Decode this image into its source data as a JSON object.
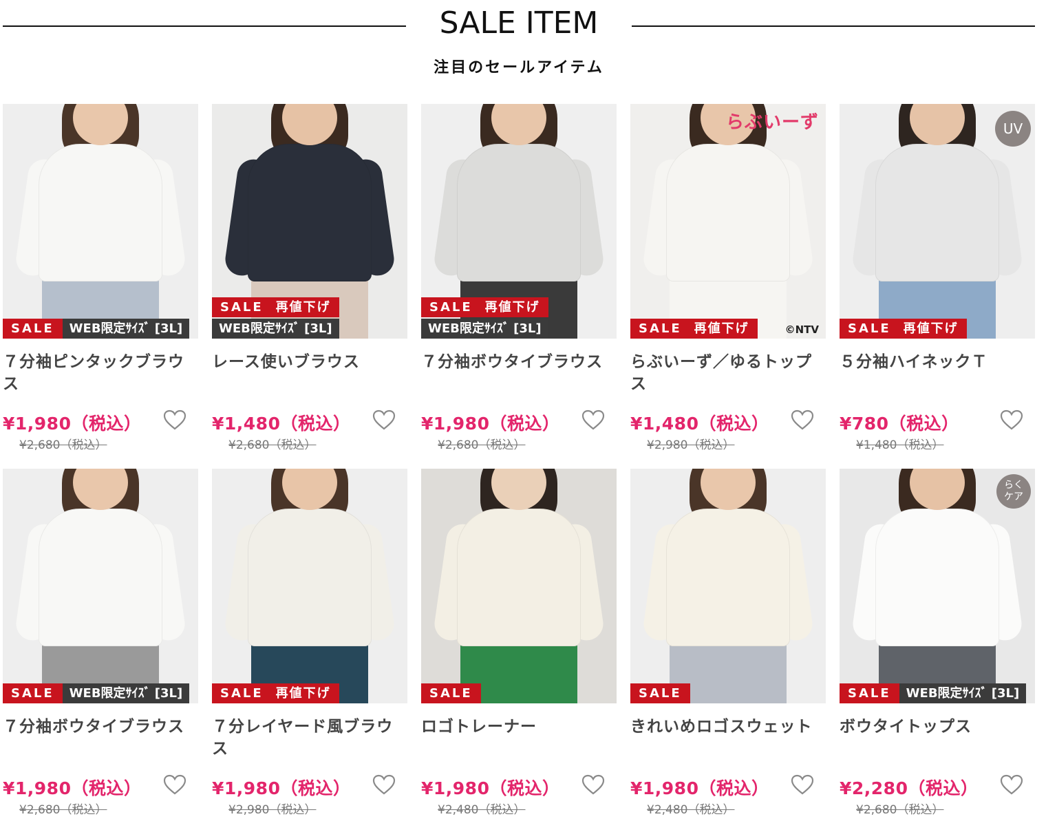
{
  "header": {
    "title": "SALE ITEM",
    "subtitle": "注目のセールアイテム"
  },
  "products": [
    {
      "name": "７分袖ピンタックブラウス",
      "price": "¥1,980（税込）",
      "original": "¥2,680（税込）",
      "tags": [
        "SALE",
        "WEB限定ｻｲｽﾞ [3L]"
      ],
      "tag_layout": "inline",
      "bg": "#eeeeee",
      "top": "#f7f7f5",
      "bottom_color": "#b5bfcc",
      "hair": "#4a3528",
      "skin": "#e9c7ab"
    },
    {
      "name": "レース使いブラウス",
      "price": "¥1,480（税込）",
      "original": "¥2,680（税込）",
      "tags": [
        "SALE",
        "再値下げ",
        "WEB限定ｻｲｽﾞ [3L]"
      ],
      "tag_layout": "stacked",
      "bg": "#ebebea",
      "top": "#2a2f3a",
      "bottom_color": "#d9c9bd",
      "hair": "#3b2a20",
      "skin": "#e6c2a5"
    },
    {
      "name": "７分袖ボウタイブラウス",
      "price": "¥1,980（税込）",
      "original": "¥2,680（税込）",
      "tags": [
        "SALE",
        "再値下げ",
        "WEB限定ｻｲｽﾞ [3L]"
      ],
      "tag_layout": "stacked",
      "bg": "#efefef",
      "top": "#dcdcda",
      "bottom_color": "#3a3a3a",
      "hair": "#3a2a20",
      "skin": "#e8c6aa"
    },
    {
      "name": "らぶいーず／ゆるトップス",
      "price": "¥1,480（税込）",
      "original": "¥2,980（税込）",
      "tags": [
        "SALE",
        "再値下げ"
      ],
      "tag_layout": "inline",
      "bg": "#f0efed",
      "top": "#f6f5f2",
      "bottom_color": "#f6f5f2",
      "hair": "#3a2a20",
      "skin": "#e8c6aa",
      "brand": "らぶいーず",
      "corner": "©NTV"
    },
    {
      "name": "５分袖ハイネックＴ",
      "price": "¥780（税込）",
      "original": "¥1,480（税込）",
      "tags": [
        "SALE",
        "再値下げ"
      ],
      "tag_layout": "inline",
      "bg": "#eeeeee",
      "top": "#e6e6e6",
      "bottom_color": "#8eaac8",
      "hair": "#2e2520",
      "skin": "#e6c3a7",
      "badge": "UV"
    },
    {
      "name": "７分袖ボウタイブラウス",
      "price": "¥1,980（税込）",
      "original": "¥2,680（税込）",
      "tags": [
        "SALE",
        "WEB限定ｻｲｽﾞ [3L]"
      ],
      "tag_layout": "inline",
      "bg": "#eeeeee",
      "top": "#f8f8f6",
      "bottom_color": "#9a9a9a",
      "hair": "#4a3528",
      "skin": "#e9c7ab"
    },
    {
      "name": "７分レイヤード風ブラウス",
      "price": "¥1,980（税込）",
      "original": "¥2,980（税込）",
      "tags": [
        "SALE",
        "再値下げ"
      ],
      "tag_layout": "inline",
      "bg": "#eeeeee",
      "top": "#f1efe8",
      "bottom_color": "#27485a",
      "hair": "#4a3528",
      "skin": "#e8c5a8"
    },
    {
      "name": "ロゴトレーナー",
      "price": "¥1,980（税込）",
      "original": "¥2,480（税込）",
      "tags": [
        "SALE"
      ],
      "tag_layout": "inline",
      "bg": "#dedcd8",
      "top": "#f3efe4",
      "bottom_color": "#2f8a4a",
      "hair": "#2e2520",
      "skin": "#ead0b8"
    },
    {
      "name": "きれいめロゴスウェット",
      "price": "¥1,980（税込）",
      "original": "¥2,480（税込）",
      "tags": [
        "SALE"
      ],
      "tag_layout": "inline",
      "bg": "#eeeeee",
      "top": "#f5f1e6",
      "bottom_color": "#b8bdc6",
      "hair": "#4a3528",
      "skin": "#e9c7ab"
    },
    {
      "name": "ボウタイトップス",
      "price": "¥2,280（税込）",
      "original": "¥2,680（税込）",
      "tags": [
        "SALE",
        "WEB限定ｻｲｽﾞ [3L]"
      ],
      "tag_layout": "inline",
      "bg": "#e8e8e8",
      "top": "#fbfbfa",
      "bottom_color": "#5f6369",
      "hair": "#3b2a20",
      "skin": "#e6c2a5",
      "badge": "らく\nケア"
    }
  ],
  "icons": {
    "heart": "heart-outline-icon"
  },
  "colors": {
    "sale_red": "#c8141e",
    "price_pink": "#e3256b",
    "web_tag": "#3b3b3b"
  }
}
